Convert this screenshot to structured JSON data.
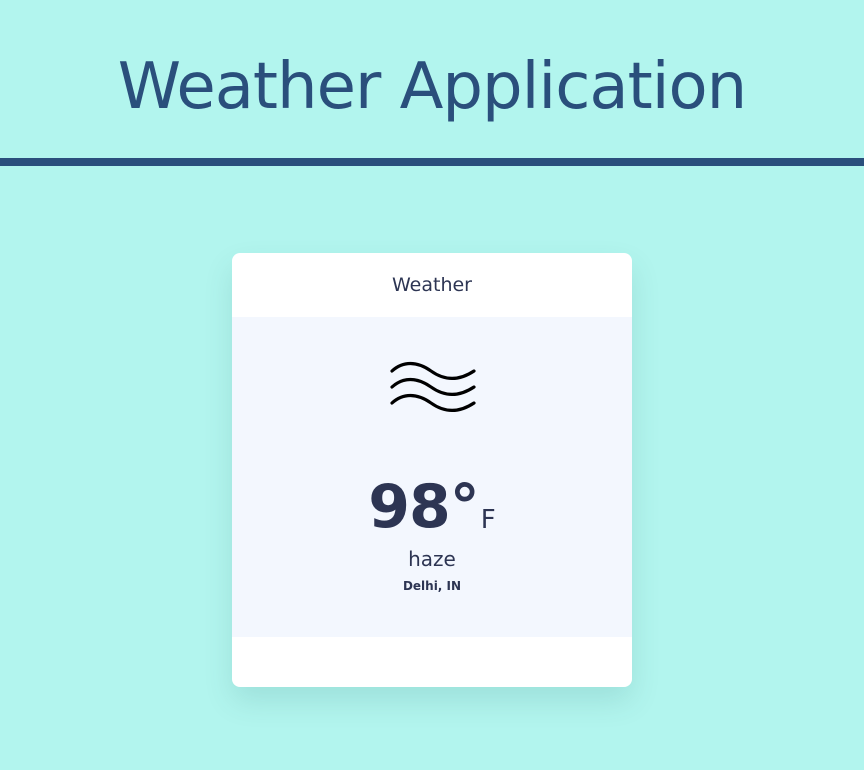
{
  "app": {
    "title": "Weather Application",
    "accent_color": "#2a4f7c",
    "background_color": "#b2f5ee"
  },
  "card": {
    "header": "Weather",
    "icon": "haze-waves-icon",
    "temperature": "98°",
    "unit": "F",
    "condition": "haze",
    "location": "Delhi, IN"
  }
}
